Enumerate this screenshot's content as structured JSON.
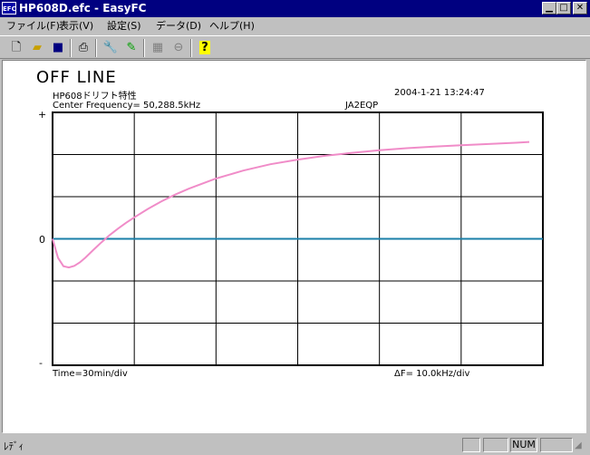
{
  "window": {
    "app_icon_text": "EFC",
    "title": "HP608D.efc - EasyFC"
  },
  "menu": [
    {
      "label": "ファイル(F)"
    },
    {
      "label": "表示(V)"
    },
    {
      "label": "設定(S)"
    },
    {
      "label": "データ(D)"
    },
    {
      "label": "ヘルプ(H)"
    }
  ],
  "toolbar": {
    "icons": [
      "new-file-icon",
      "open-folder-icon",
      "save-icon",
      "print-icon",
      "wrench-icon",
      "marker-icon",
      "grid-disabled-icon",
      "stop-disabled-icon",
      "help-icon"
    ]
  },
  "plot": {
    "mode": "OFF LINE",
    "name": "HP608ドリフト特性",
    "datetime": "2004-1-21  13:24:47",
    "center_frequency": "Center Frequency=   50,288.5kHz",
    "callsign": "JA2EQP",
    "time_div": "Time=30min/div",
    "freq_div": "ΔF=    10.0kHz/div",
    "y_top_label": "+",
    "y_zero_label": "0",
    "y_bottom_label": "-",
    "grid_color": "#000000",
    "zero_line_color": "#1a7fa8",
    "curve_color": "#f08cc8"
  },
  "chart_data": {
    "type": "line",
    "xlabel": "Time=30min/div",
    "ylabel": "",
    "x_unit_note": "minutes",
    "y_unit_note": "kHz deviation",
    "xlim": [
      0,
      180
    ],
    "ylim": [
      -30,
      30
    ],
    "grid": true,
    "series": [
      {
        "values_x": [
          0,
          2,
          4,
          6,
          8,
          10,
          12,
          15,
          18,
          21,
          24,
          27,
          30,
          35,
          40,
          45,
          50,
          55,
          60,
          70,
          80,
          90,
          100,
          110,
          120,
          130,
          140,
          150,
          160,
          170,
          175
        ],
        "values_y": [
          0,
          -4.5,
          -6.5,
          -6.8,
          -6.4,
          -5.6,
          -4.5,
          -2.6,
          -0.8,
          0.9,
          2.4,
          3.8,
          5.1,
          7.1,
          8.9,
          10.5,
          11.9,
          13.1,
          14.3,
          16.2,
          17.7,
          18.8,
          19.7,
          20.4,
          21.0,
          21.5,
          21.9,
          22.2,
          22.5,
          22.8,
          23.0
        ]
      }
    ]
  },
  "status": {
    "text": "ﾚﾃﾞｨ",
    "num": "NUM"
  }
}
